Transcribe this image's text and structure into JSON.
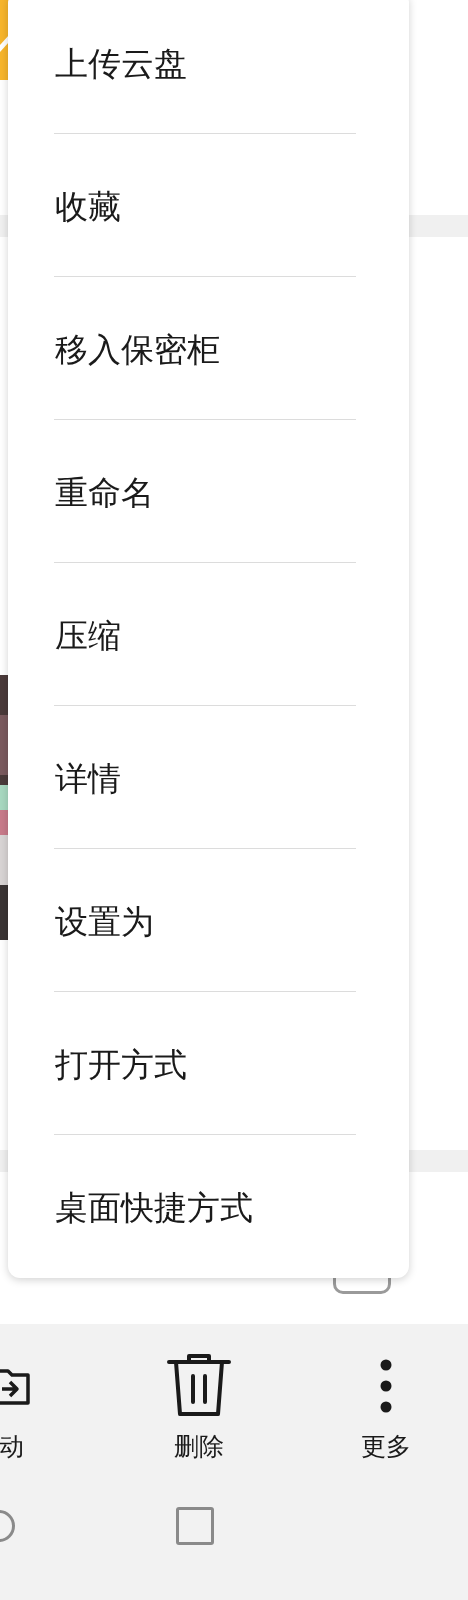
{
  "menu": {
    "items": [
      {
        "label": "上传云盘"
      },
      {
        "label": "收藏"
      },
      {
        "label": "移入保密柜"
      },
      {
        "label": "重命名"
      },
      {
        "label": "压缩"
      },
      {
        "label": "详情"
      },
      {
        "label": "设置为"
      },
      {
        "label": "打开方式"
      },
      {
        "label": "桌面快捷方式"
      }
    ]
  },
  "checkbox": {
    "checked": false
  },
  "toolbar": [
    {
      "kind": "move",
      "label": "动"
    },
    {
      "kind": "delete",
      "label": "删除"
    },
    {
      "kind": "more",
      "label": "更多"
    }
  ]
}
